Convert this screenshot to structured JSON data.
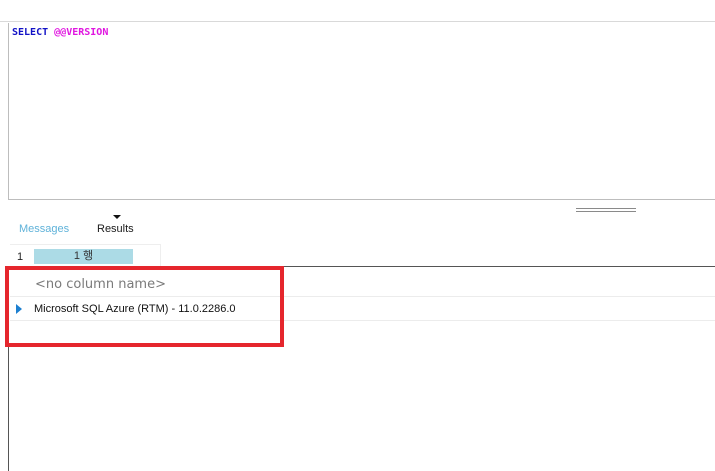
{
  "editor": {
    "query_keyword": "SELECT",
    "query_function": "@@VERSION"
  },
  "tabs": {
    "messages_label": "Messages",
    "results_label": "Results"
  },
  "pager": {
    "page_number": "1",
    "rows_label": "1 행"
  },
  "grid": {
    "column_header": "<no column name>",
    "rows": [
      "Microsoft SQL Azure (RTM) - 11.0.2286.0"
    ]
  },
  "colors": {
    "keyword": "#1212c6",
    "function": "#e016e0",
    "messages_tab": "#5fb2d9",
    "rows_badge": "#acdbe6",
    "highlight": "#e5262d",
    "row_indicator": "#1c7fd0"
  },
  "icons": {
    "results_dropdown": "caret-down-icon",
    "row_indicator": "triangle-right-icon"
  }
}
